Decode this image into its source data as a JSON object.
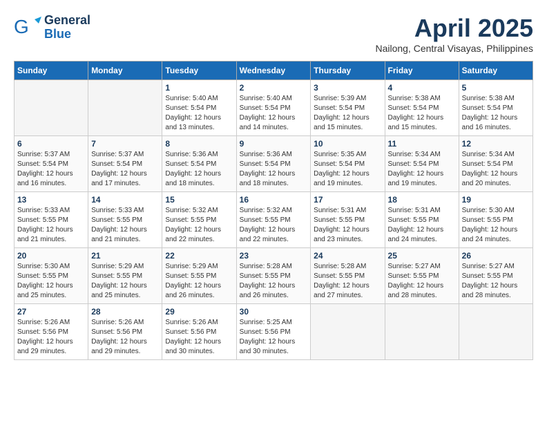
{
  "logo": {
    "line1": "General",
    "line2": "Blue"
  },
  "title": "April 2025",
  "location": "Nailong, Central Visayas, Philippines",
  "days_of_week": [
    "Sunday",
    "Monday",
    "Tuesday",
    "Wednesday",
    "Thursday",
    "Friday",
    "Saturday"
  ],
  "weeks": [
    [
      {
        "day": "",
        "info": ""
      },
      {
        "day": "",
        "info": ""
      },
      {
        "day": "1",
        "info": "Sunrise: 5:40 AM\nSunset: 5:54 PM\nDaylight: 12 hours and 13 minutes."
      },
      {
        "day": "2",
        "info": "Sunrise: 5:40 AM\nSunset: 5:54 PM\nDaylight: 12 hours and 14 minutes."
      },
      {
        "day": "3",
        "info": "Sunrise: 5:39 AM\nSunset: 5:54 PM\nDaylight: 12 hours and 15 minutes."
      },
      {
        "day": "4",
        "info": "Sunrise: 5:38 AM\nSunset: 5:54 PM\nDaylight: 12 hours and 15 minutes."
      },
      {
        "day": "5",
        "info": "Sunrise: 5:38 AM\nSunset: 5:54 PM\nDaylight: 12 hours and 16 minutes."
      }
    ],
    [
      {
        "day": "6",
        "info": "Sunrise: 5:37 AM\nSunset: 5:54 PM\nDaylight: 12 hours and 16 minutes."
      },
      {
        "day": "7",
        "info": "Sunrise: 5:37 AM\nSunset: 5:54 PM\nDaylight: 12 hours and 17 minutes."
      },
      {
        "day": "8",
        "info": "Sunrise: 5:36 AM\nSunset: 5:54 PM\nDaylight: 12 hours and 18 minutes."
      },
      {
        "day": "9",
        "info": "Sunrise: 5:36 AM\nSunset: 5:54 PM\nDaylight: 12 hours and 18 minutes."
      },
      {
        "day": "10",
        "info": "Sunrise: 5:35 AM\nSunset: 5:54 PM\nDaylight: 12 hours and 19 minutes."
      },
      {
        "day": "11",
        "info": "Sunrise: 5:34 AM\nSunset: 5:54 PM\nDaylight: 12 hours and 19 minutes."
      },
      {
        "day": "12",
        "info": "Sunrise: 5:34 AM\nSunset: 5:54 PM\nDaylight: 12 hours and 20 minutes."
      }
    ],
    [
      {
        "day": "13",
        "info": "Sunrise: 5:33 AM\nSunset: 5:55 PM\nDaylight: 12 hours and 21 minutes."
      },
      {
        "day": "14",
        "info": "Sunrise: 5:33 AM\nSunset: 5:55 PM\nDaylight: 12 hours and 21 minutes."
      },
      {
        "day": "15",
        "info": "Sunrise: 5:32 AM\nSunset: 5:55 PM\nDaylight: 12 hours and 22 minutes."
      },
      {
        "day": "16",
        "info": "Sunrise: 5:32 AM\nSunset: 5:55 PM\nDaylight: 12 hours and 22 minutes."
      },
      {
        "day": "17",
        "info": "Sunrise: 5:31 AM\nSunset: 5:55 PM\nDaylight: 12 hours and 23 minutes."
      },
      {
        "day": "18",
        "info": "Sunrise: 5:31 AM\nSunset: 5:55 PM\nDaylight: 12 hours and 24 minutes."
      },
      {
        "day": "19",
        "info": "Sunrise: 5:30 AM\nSunset: 5:55 PM\nDaylight: 12 hours and 24 minutes."
      }
    ],
    [
      {
        "day": "20",
        "info": "Sunrise: 5:30 AM\nSunset: 5:55 PM\nDaylight: 12 hours and 25 minutes."
      },
      {
        "day": "21",
        "info": "Sunrise: 5:29 AM\nSunset: 5:55 PM\nDaylight: 12 hours and 25 minutes."
      },
      {
        "day": "22",
        "info": "Sunrise: 5:29 AM\nSunset: 5:55 PM\nDaylight: 12 hours and 26 minutes."
      },
      {
        "day": "23",
        "info": "Sunrise: 5:28 AM\nSunset: 5:55 PM\nDaylight: 12 hours and 26 minutes."
      },
      {
        "day": "24",
        "info": "Sunrise: 5:28 AM\nSunset: 5:55 PM\nDaylight: 12 hours and 27 minutes."
      },
      {
        "day": "25",
        "info": "Sunrise: 5:27 AM\nSunset: 5:55 PM\nDaylight: 12 hours and 28 minutes."
      },
      {
        "day": "26",
        "info": "Sunrise: 5:27 AM\nSunset: 5:55 PM\nDaylight: 12 hours and 28 minutes."
      }
    ],
    [
      {
        "day": "27",
        "info": "Sunrise: 5:26 AM\nSunset: 5:56 PM\nDaylight: 12 hours and 29 minutes."
      },
      {
        "day": "28",
        "info": "Sunrise: 5:26 AM\nSunset: 5:56 PM\nDaylight: 12 hours and 29 minutes."
      },
      {
        "day": "29",
        "info": "Sunrise: 5:26 AM\nSunset: 5:56 PM\nDaylight: 12 hours and 30 minutes."
      },
      {
        "day": "30",
        "info": "Sunrise: 5:25 AM\nSunset: 5:56 PM\nDaylight: 12 hours and 30 minutes."
      },
      {
        "day": "",
        "info": ""
      },
      {
        "day": "",
        "info": ""
      },
      {
        "day": "",
        "info": ""
      }
    ]
  ]
}
